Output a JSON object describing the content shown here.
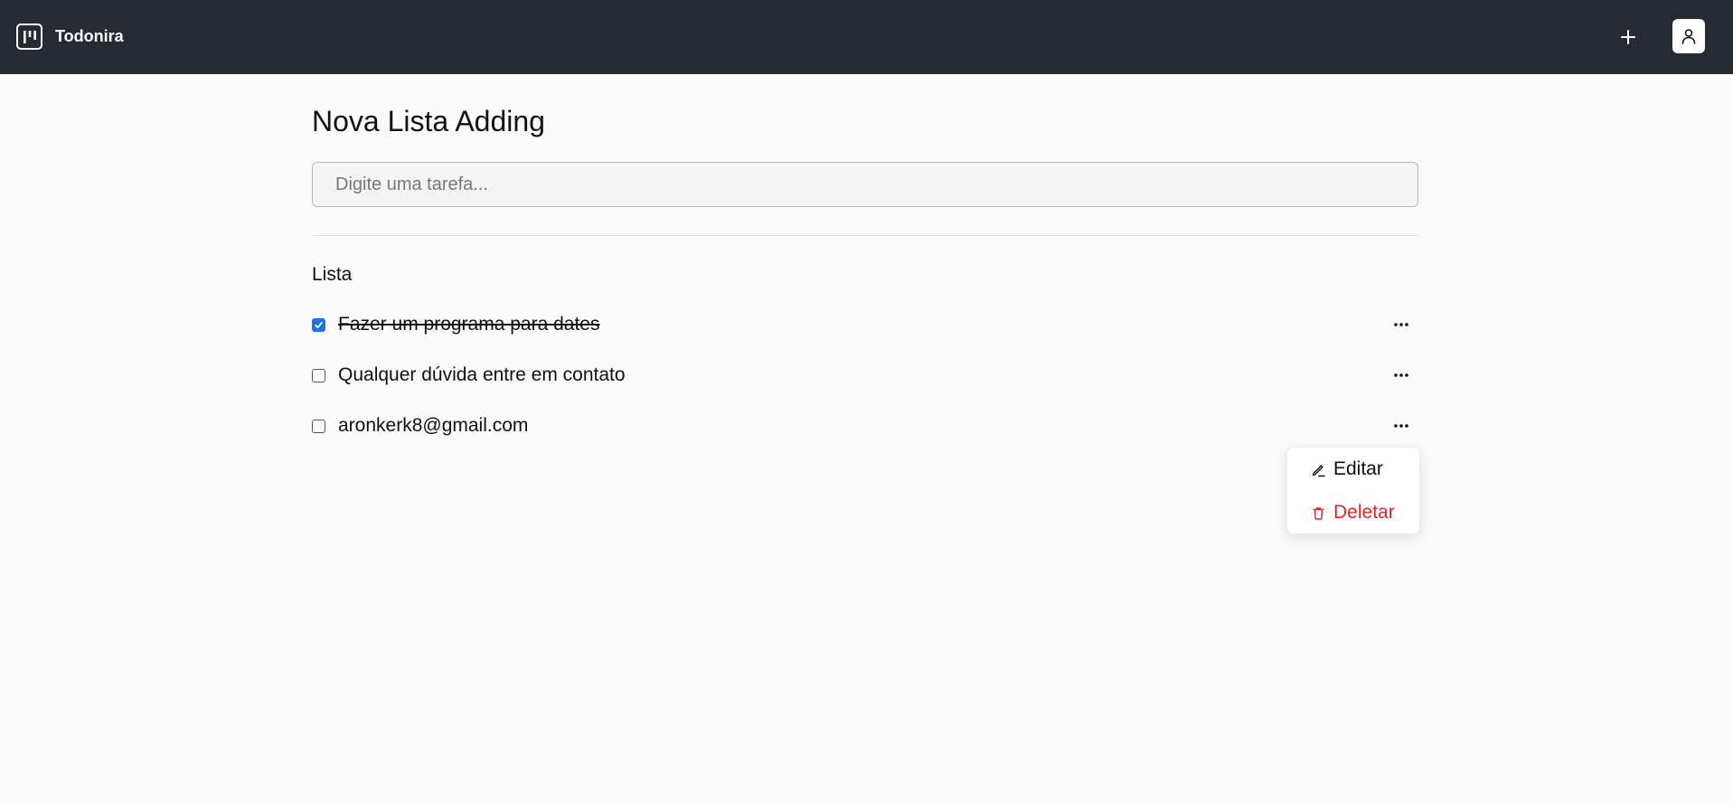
{
  "app": {
    "name": "Todonira",
    "logo_icon": "kanban-board-icon",
    "add_icon": "plus-icon",
    "user_icon": "user-icon"
  },
  "list": {
    "title": "Nova Lista Adding",
    "input_placeholder": "Digite uma tarefa...",
    "input_value": "",
    "heading": "Lista",
    "tasks": [
      {
        "label": "Fazer um programa para dates",
        "completed": true
      },
      {
        "label": "Qualquer dúvida entre em contato",
        "completed": false
      },
      {
        "label": "aronkerk8@gmail.com",
        "completed": false
      }
    ]
  },
  "context_menu": {
    "open_for_task": 2,
    "edit_label": "Editar",
    "edit_icon": "pencil-icon",
    "delete_label": "Deletar",
    "delete_icon": "trash-icon"
  },
  "colors": {
    "topbar": "#252a33",
    "background": "#fafafa",
    "checkbox_checked": "#1a73e8",
    "danger": "#e5242b"
  }
}
